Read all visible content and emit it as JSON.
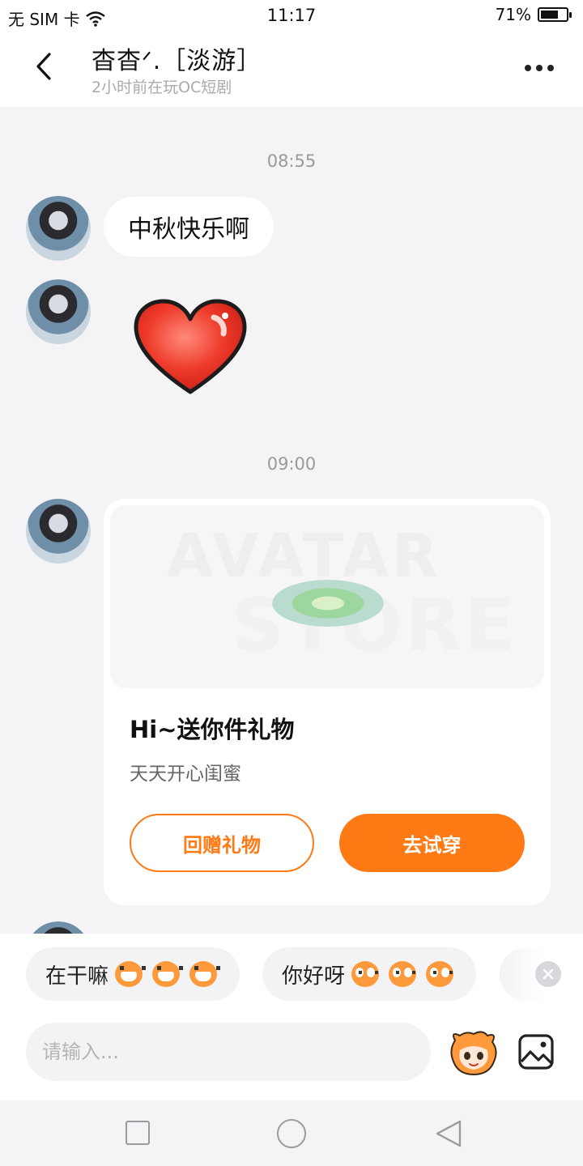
{
  "status_bar": {
    "carrier": "无 SIM 卡",
    "time": "11:17",
    "battery_percent": "71%",
    "battery_level": 0.71
  },
  "header": {
    "title": "杳杳ᐟ.［淡游］",
    "subtitle": "2小时前在玩OC短剧"
  },
  "messages": [
    {
      "time": "08:55"
    },
    {
      "type": "text",
      "text": "中秋快乐啊"
    },
    {
      "type": "sticker",
      "icon": "red-heart-icon"
    },
    {
      "time": "09:00"
    },
    {
      "type": "gift_card",
      "image_text_top": "AVATAR",
      "image_text_bottom": "STORE",
      "title": "Hi~送你件礼物",
      "subtitle": "天天开心闺蜜",
      "secondary_button": "回赠礼物",
      "primary_button": "去试穿"
    }
  ],
  "quick_replies": [
    {
      "text": "在干嘛",
      "emoji": "grinning-monkey-icon"
    },
    {
      "text": "你好呀",
      "emoji": "wide-eyed-monkey-icon"
    }
  ],
  "input": {
    "placeholder": "请输入..."
  },
  "colors": {
    "accent": "#ff7a14",
    "background": "#f4f4f7",
    "card": "#ffffff"
  }
}
